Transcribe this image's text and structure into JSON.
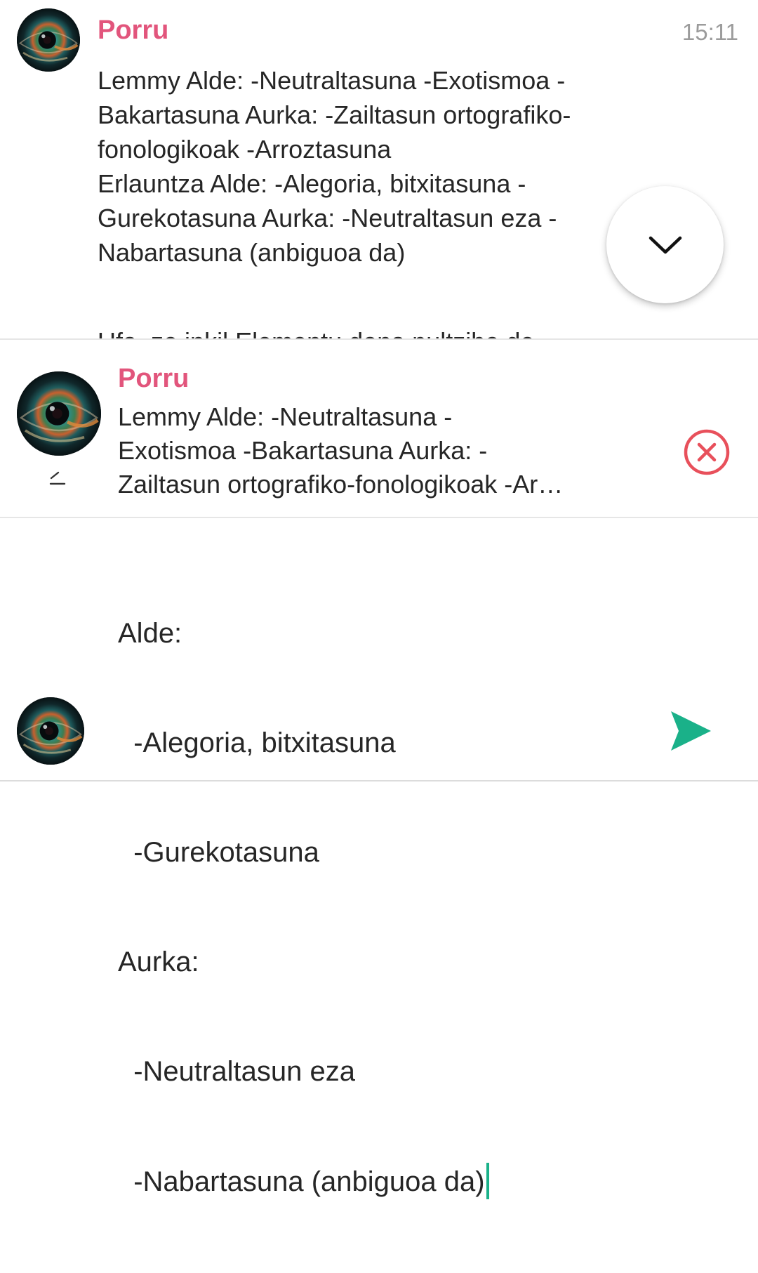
{
  "message": {
    "author": "Porru",
    "time": "15:11",
    "lines": [
      "Lemmy Alde: -Neutraltasuna -Exotismoa -",
      "Bakartasuna Aurka: -Zailtasun ortografiko-",
      "fonologikoak -Arroztasuna",
      "Erlauntza Alde: -Alegoria, bitxitasuna -",
      "Gurekotasuna Aurka: -Neutraltasun eza -",
      "Nabartasuna (anbiguoa da)"
    ],
    "cut_off_line": "Ufa, ze inkil Elementu dona pultzibe de"
  },
  "scroll_button": {
    "icon": "chevron-down-icon"
  },
  "reply": {
    "author": "Porru",
    "lines": [
      "Lemmy Alde: -Neutraltasuna -",
      "Exotismoa -Bakartasuna Aurka: -",
      "Zailtasun ortografiko-fonologikoak -Ar…"
    ],
    "edit_icon": "pencil-icon",
    "close_icon": "close-circle-icon",
    "close_color": "#e8505b"
  },
  "composer": {
    "lines": [
      "Alde:",
      "  -Alegoria, bitxitasuna",
      "  -Gurekotasuna",
      "Aurka:",
      "  -Neutraltasun eza",
      "  -Nabartasuna (anbiguoa da)"
    ],
    "send_icon": "send-icon",
    "send_color": "#1ab189"
  },
  "colors": {
    "author": "#e2557c",
    "timestamp": "#9b9b9b",
    "text": "#262626"
  }
}
